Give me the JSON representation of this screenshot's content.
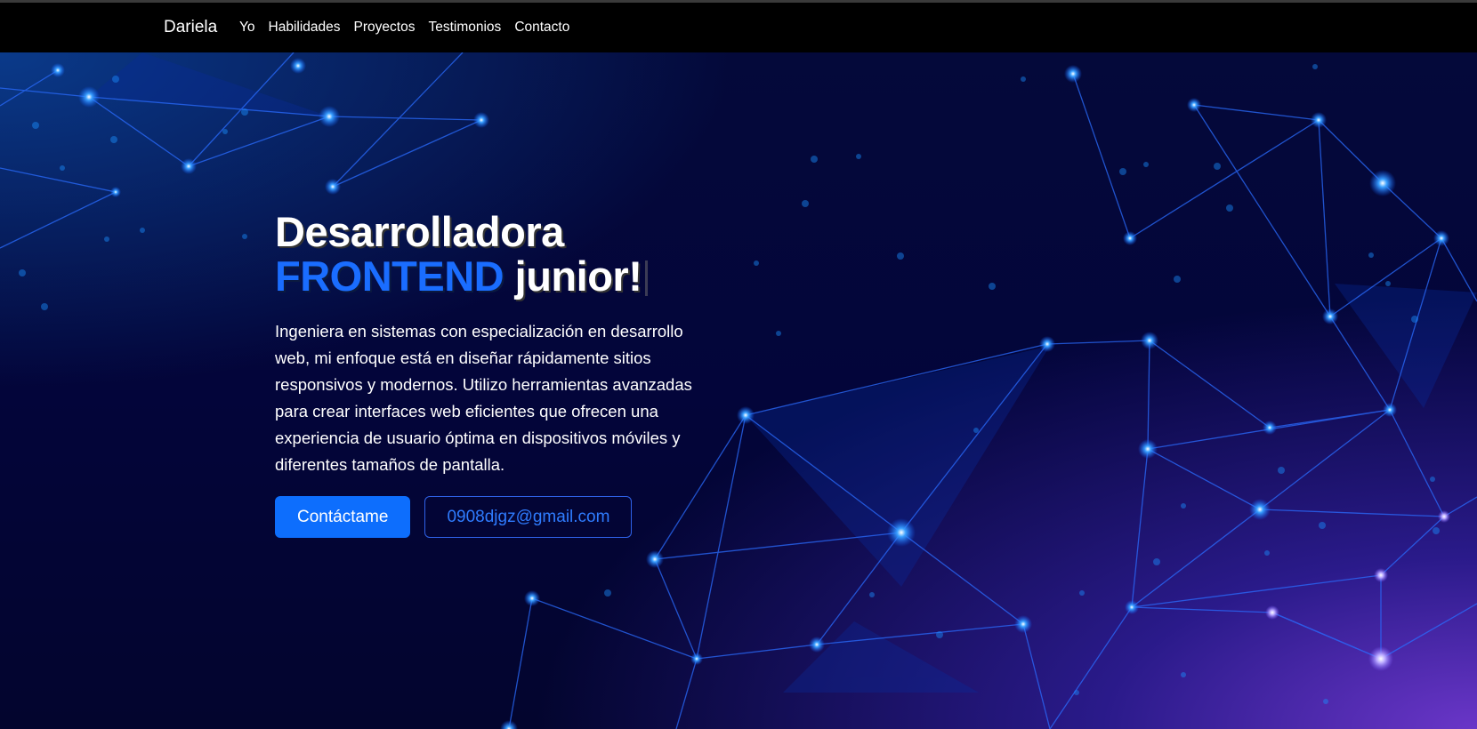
{
  "nav": {
    "brand": "Dariela",
    "links": [
      "Yo",
      "Habilidades",
      "Proyectos",
      "Testimonios",
      "Contacto"
    ]
  },
  "hero": {
    "title_line1": "Desarrolladora",
    "title_accent": "FRONTEND",
    "title_rest": "junior!",
    "description": "Ingeniera en sistemas con especialización en desarrollo web, mi enfoque está en diseñar rápidamente sitios responsivos y modernos. Utilizo herramientas avanzadas para crear interfaces web eficientes que ofrecen una experiencia de usuario óptima en dispositivos móviles y diferentes tamaños de pantalla.",
    "primary_button": "Contáctame",
    "email_button": "0908djgz@gmail.com"
  },
  "colors": {
    "accent": "#1a6dff",
    "primary_button": "#0d6efd",
    "navbar": "#000000",
    "hero_background": "#03053a"
  }
}
